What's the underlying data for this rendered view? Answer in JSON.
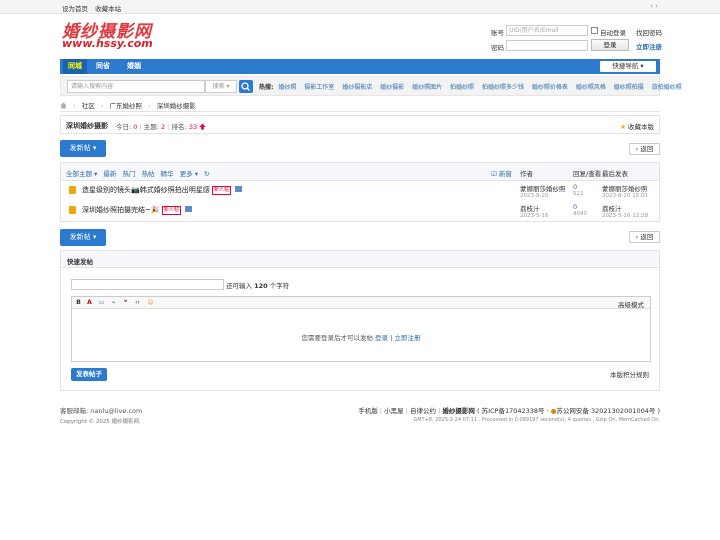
{
  "topbar": {
    "set_home": "设为首页",
    "bookmark": "收藏本站",
    "arrows": "‹ ›"
  },
  "logo": {
    "cn": "婚纱摄影网",
    "en": "www.hssy.com"
  },
  "login": {
    "account_label": "账号",
    "account_placeholder": "UID/用户名/Email",
    "auto_login": "自动登录",
    "forgot": "找回密码",
    "password_label": "密码",
    "login_button": "登录",
    "register": "立即注册"
  },
  "nav": {
    "items": [
      "同城",
      "同省",
      "婚姻"
    ],
    "quick_nav": "快捷导航 ▾"
  },
  "search": {
    "placeholder": "请输入搜索内容",
    "type": "搜索 ▾",
    "hot_label": "热搜:",
    "hot_words": [
      "婚纱照",
      "摄影工作室",
      "婚纱摄影店",
      "婚纱摄影",
      "婚纱照图片",
      "拍婚纱照",
      "拍婚纱照多少钱",
      "婚纱照价格表",
      "婚纱照风格",
      "婚纱照拍摄",
      "旅拍婚纱照"
    ]
  },
  "breadcrumb": {
    "items": [
      "社区",
      "广东婚纱照",
      "深圳婚纱摄影"
    ]
  },
  "forum": {
    "name": "深圳婚纱摄影",
    "today_label": "今日:",
    "today": "0",
    "topics_label": "主题:",
    "topics": "2",
    "rank_label": "排名:",
    "rank": "33",
    "favorite": "收藏本版"
  },
  "buttons": {
    "new_post": "发新帖 ▾",
    "back": "‹ 返回"
  },
  "thread_list": {
    "filters": [
      "全部主题 ▾",
      "最新",
      "热门",
      "热帖",
      "精华",
      "更多 ▾",
      "↻"
    ],
    "col_new": "☑ 新窗",
    "col_author": "作者",
    "col_replies": "回复/查看",
    "col_last": "最后发表",
    "rows": [
      {
        "title": "造星级别的镜头📷韩式婚纱照拍出明星感",
        "badge": "新人帖",
        "author": "蒙娜丽莎婚纱照",
        "date": "2023-8-20",
        "replies": "0",
        "views": "522",
        "last_user": "蒙娜丽莎婚纱照",
        "last_time": "2023-8-20 15:01"
      },
      {
        "title": "深圳婚纱照拍摄完结~🎉",
        "badge": "新人帖",
        "author": "荔枝汁",
        "date": "2023-5-16",
        "replies": "0",
        "views": "4040",
        "last_user": "荔枝汁",
        "last_time": "2023-5-16 12:28"
      }
    ]
  },
  "quick_post": {
    "title": "快速发帖",
    "tip_prefix": "还可输入",
    "tip_count": "120",
    "tip_suffix": "个字符",
    "toolbar": [
      "B",
      "A",
      "▭",
      "⌁",
      "❝",
      "‹›",
      "☺"
    ],
    "advanced": "高级模式",
    "notice": "您需要登录后才可以发帖",
    "login": "登录",
    "divider": " | ",
    "register": "立即注册",
    "submit": "发表帖子",
    "rules": "本版积分规则"
  },
  "footer": {
    "email_label": "客服邮箱:",
    "email": "nanlu@live.com",
    "copyright": "Copyright © 2025 婚纱摄影网.",
    "links": [
      "手机版",
      "小黑屋",
      "自律公约"
    ],
    "site": "婚纱摄影网",
    "icp": "( 苏ICP备17042338号 ·",
    "police": "苏公网安备 32021302001004号 )",
    "stats": "GMT+8, 2025-3-24 07:11 , Processed in 0.089197 second(s), 4 queries , Gzip On, MemCached On."
  },
  "colors": {
    "accent": "#2b7acd",
    "nav_active": "#1d62ad",
    "logo": "#e0383e",
    "highlight": "#ee0033"
  }
}
